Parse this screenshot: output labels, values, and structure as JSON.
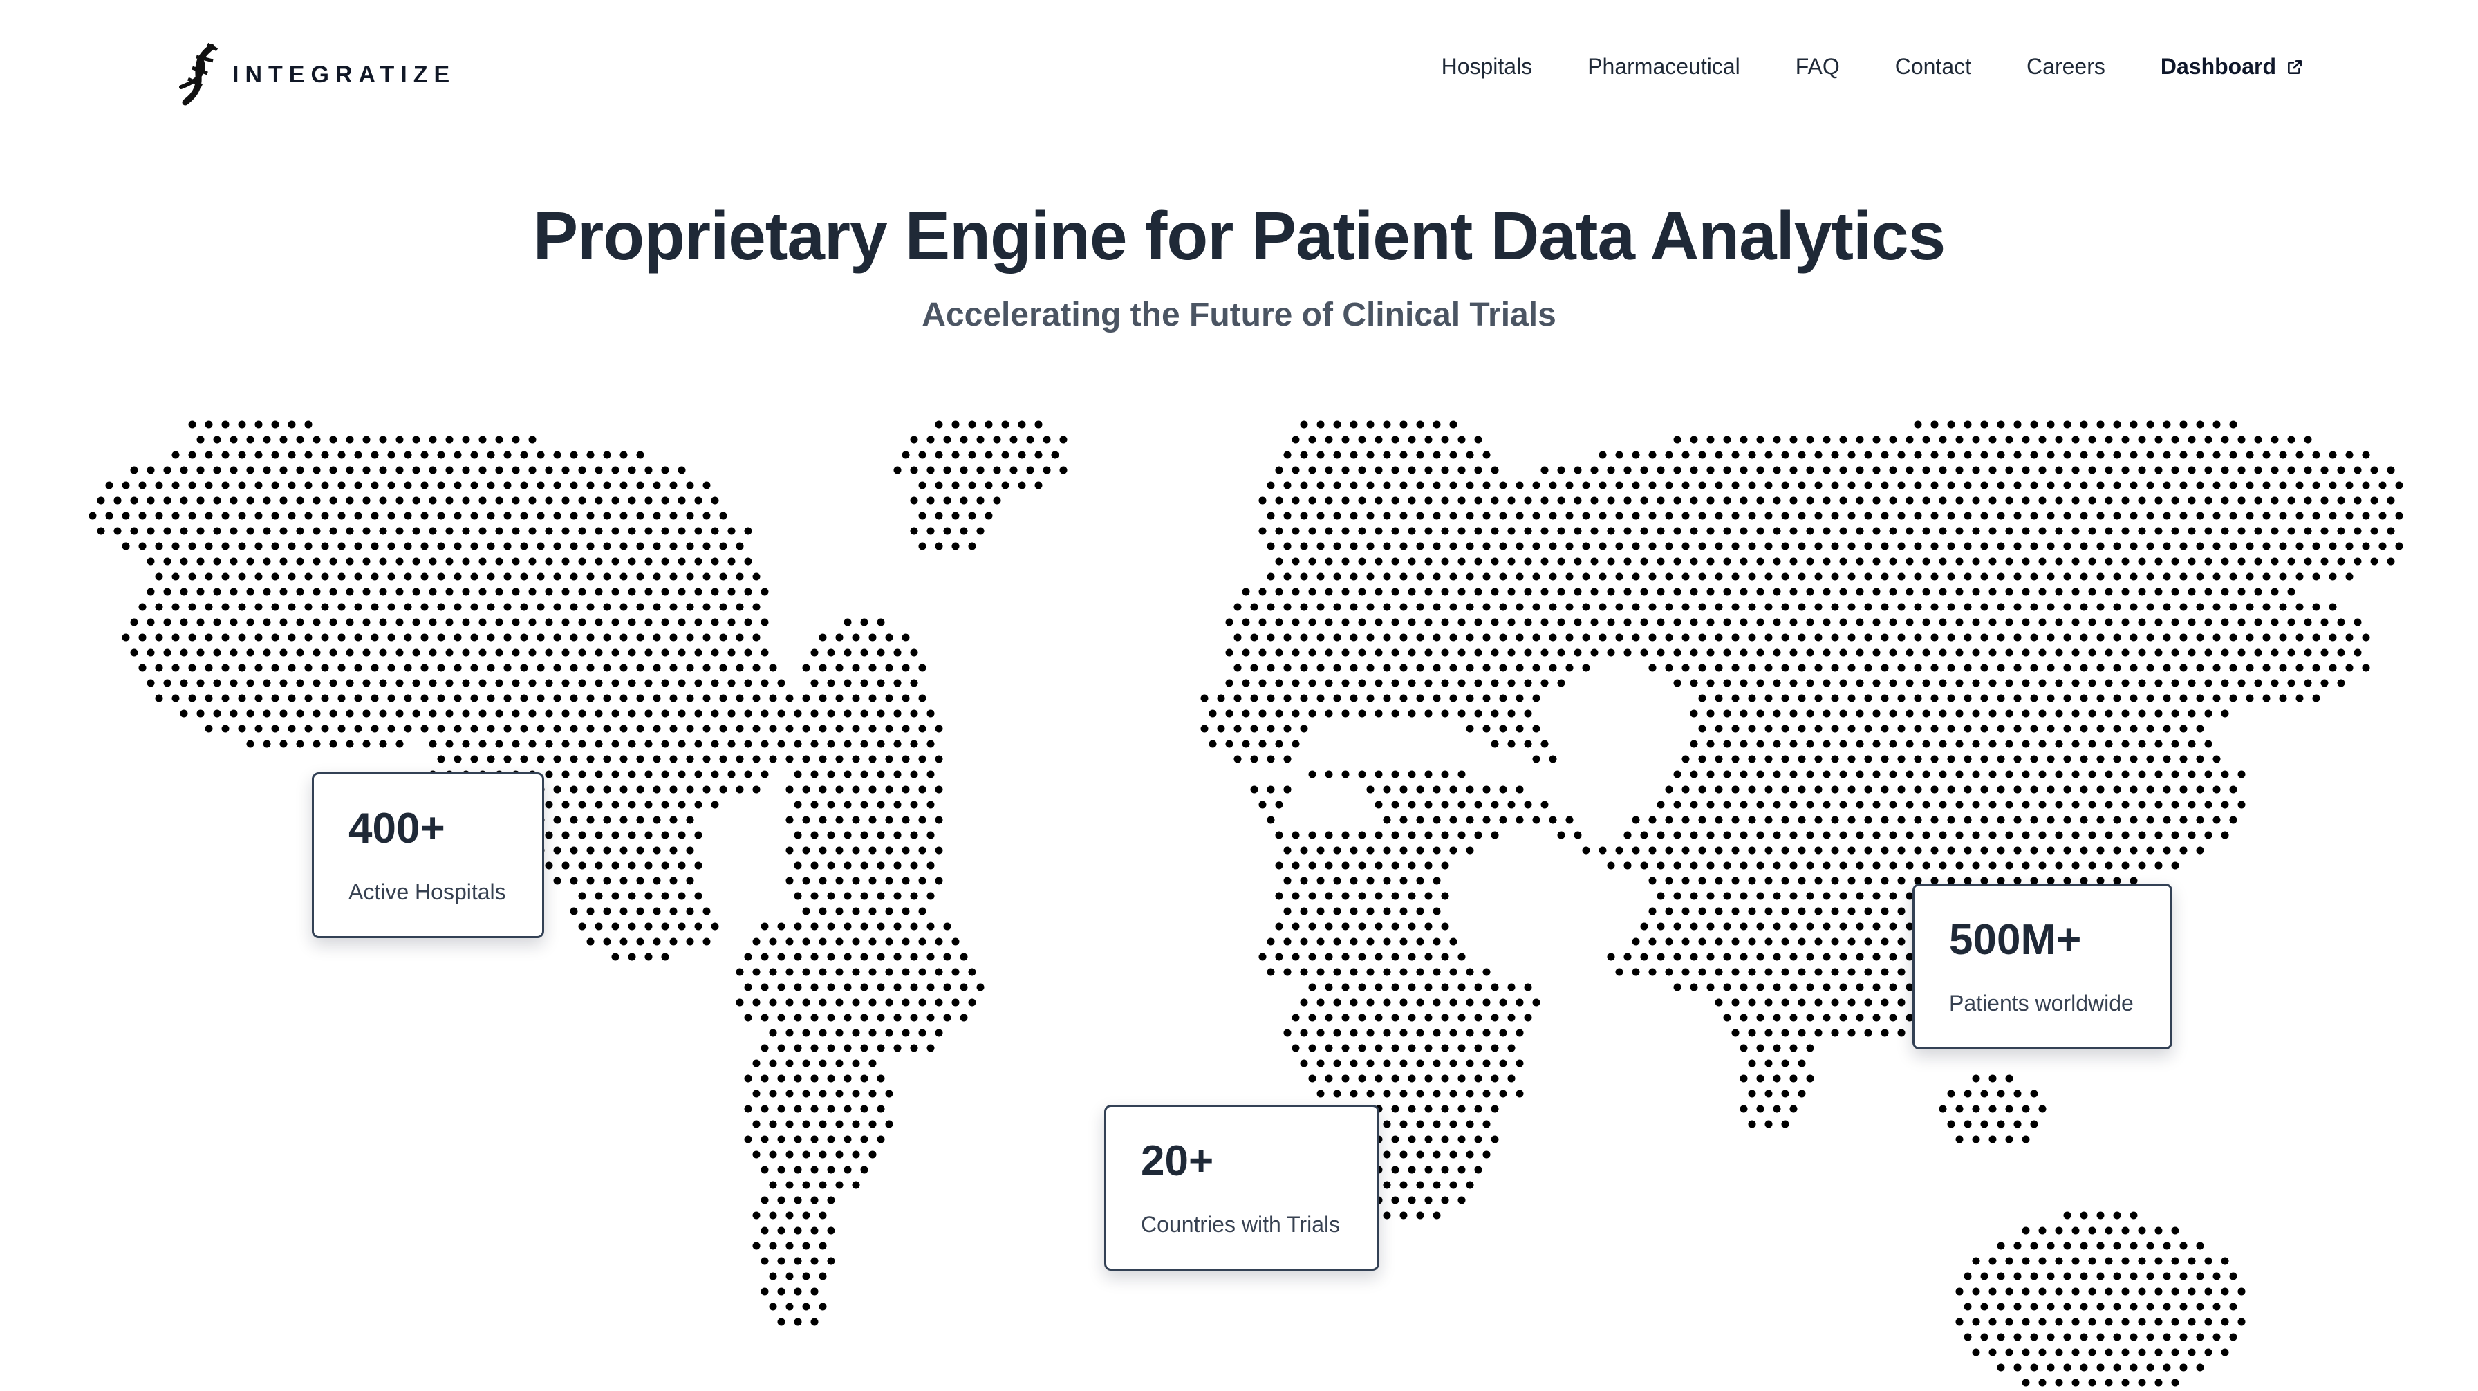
{
  "header": {
    "logo_text": "INTEGRATIZE",
    "nav": [
      {
        "label": "Hospitals"
      },
      {
        "label": "Pharmaceutical"
      },
      {
        "label": "FAQ"
      },
      {
        "label": "Contact"
      },
      {
        "label": "Careers"
      },
      {
        "label": "Dashboard",
        "icon": "external-link-icon"
      }
    ]
  },
  "hero": {
    "title": "Proprietary Engine for Patient Data Analytics",
    "subtitle": "Accelerating the Future of Clinical Trials"
  },
  "stats": [
    {
      "value": "400+",
      "label": "Active Hospitals"
    },
    {
      "value": "20+",
      "label": "Countries with Trials"
    },
    {
      "value": "500M+",
      "label": "Patients worldwide"
    }
  ],
  "map": {
    "style": "dotted-world-map",
    "dot_color": "#000000"
  },
  "colors": {
    "text": "#1f2937",
    "muted": "#4b5563",
    "card_border": "#334155"
  }
}
